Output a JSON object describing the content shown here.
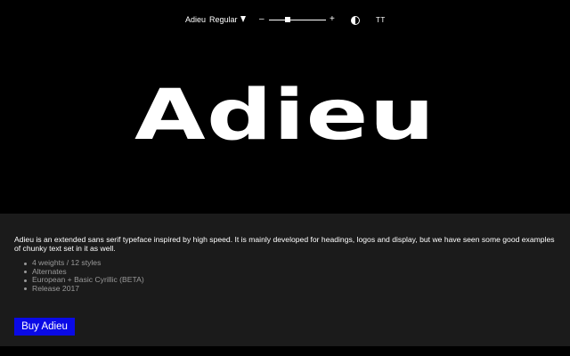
{
  "toolbar": {
    "font_name": "Adieu",
    "style_name": "Regular",
    "size_minus": "–",
    "size_plus": "+",
    "size_slider_value": 0.33,
    "case_toggle": "TT"
  },
  "specimen": {
    "text": "Adieu"
  },
  "info": {
    "description": "Adieu is an extended sans serif typeface inspired by high speed. It is mainly developed for headings, logos and display, but we have seen some good examples of chunky text set in it as well.",
    "features": [
      "4 weights / 12 styles",
      "Alternates",
      "European + Basic Cyrillic (BETA)",
      "Release 2017"
    ],
    "buy_label": "Buy Adieu"
  },
  "colors": {
    "background": "#000000",
    "panel": "#1b1b1b",
    "accent": "#0a0ae6",
    "muted_text": "#9a9a9a"
  },
  "icons": {
    "dropdown": "triangle-down-icon",
    "contrast": "half-circle-contrast-icon"
  }
}
